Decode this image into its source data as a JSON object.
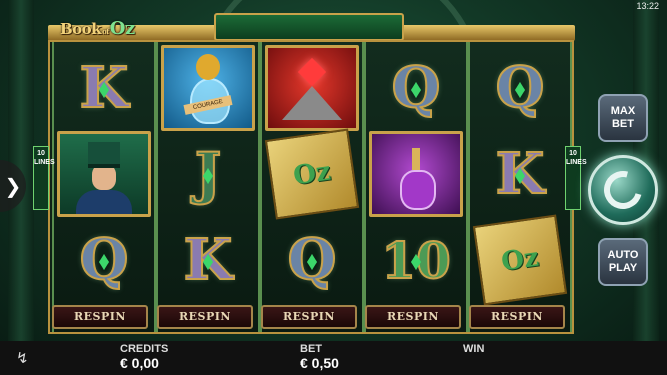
{
  "status": {
    "time": "13:22"
  },
  "logo": {
    "part1": "Book",
    "part2": "of",
    "part3": "Oz"
  },
  "reels": [
    [
      {
        "type": "letter",
        "text": "K",
        "cls": "k"
      },
      {
        "type": "man"
      },
      {
        "type": "letter",
        "text": "Q",
        "cls": ""
      }
    ],
    [
      {
        "type": "lion",
        "label": "COURAGE"
      },
      {
        "type": "letter",
        "text": "J",
        "cls": "j"
      },
      {
        "type": "letter",
        "text": "K",
        "cls": "k"
      }
    ],
    [
      {
        "type": "heart"
      },
      {
        "type": "book",
        "text": "Oz"
      },
      {
        "type": "letter",
        "text": "Q",
        "cls": ""
      }
    ],
    [
      {
        "type": "letter",
        "text": "Q",
        "cls": ""
      },
      {
        "type": "potion"
      },
      {
        "type": "letter",
        "text": "10",
        "cls": "ten"
      }
    ],
    [
      {
        "type": "letter",
        "text": "Q",
        "cls": ""
      },
      {
        "type": "letter",
        "text": "K",
        "cls": "k"
      },
      {
        "type": "book",
        "text": "Oz"
      }
    ]
  ],
  "respin_label": "RESPIN",
  "lines": {
    "count": "10",
    "label": "LINES"
  },
  "buttons": {
    "max_bet_1": "MAX",
    "max_bet_2": "BET",
    "auto_play_1": "AUTO",
    "auto_play_2": "PLAY"
  },
  "footer": {
    "credits_label": "CREDITS",
    "credits_value": "€ 0,00",
    "bet_label": "BET",
    "bet_value": "€ 0,50",
    "win_label": "WIN",
    "win_value": ""
  },
  "icons": {
    "nav": "chevron-right-icon",
    "bolt": "lightning-icon",
    "spin": "spin-arrow-icon"
  },
  "colors": {
    "frame": "#c9a24a",
    "felt": "#123826",
    "lines": "#6fd26f"
  }
}
